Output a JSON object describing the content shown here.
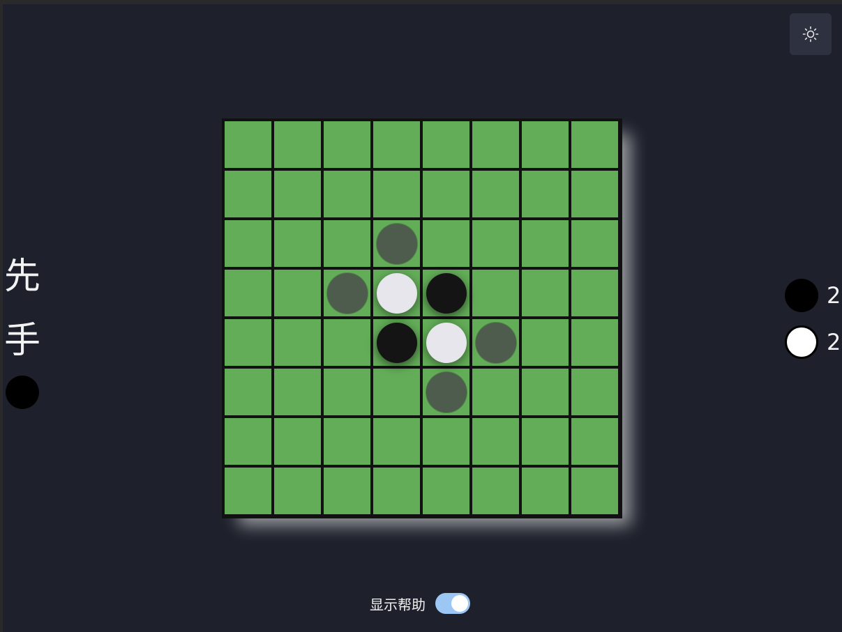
{
  "turn": {
    "label_chars": [
      "先",
      "手"
    ],
    "current_player": "black"
  },
  "scores": {
    "black": "2",
    "white": "2"
  },
  "board": {
    "size": 8,
    "pieces": [
      {
        "row": 3,
        "col": 3,
        "color": "white"
      },
      {
        "row": 3,
        "col": 4,
        "color": "black"
      },
      {
        "row": 4,
        "col": 3,
        "color": "black"
      },
      {
        "row": 4,
        "col": 4,
        "color": "white"
      }
    ],
    "hints": [
      {
        "row": 2,
        "col": 3
      },
      {
        "row": 3,
        "col": 2
      },
      {
        "row": 4,
        "col": 5
      },
      {
        "row": 5,
        "col": 4
      }
    ]
  },
  "help": {
    "label": "显示帮助",
    "enabled": true
  },
  "theme_button": {
    "icon": "sun-icon"
  },
  "colors": {
    "background": "#1e212c",
    "board_green": "#63ad58",
    "grid_line": "#111111",
    "toggle_on": "#9cc7f5"
  }
}
